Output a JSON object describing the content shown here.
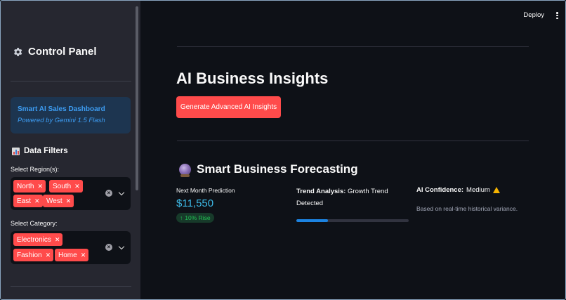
{
  "sidebar": {
    "title": "Control Panel",
    "title_icon": "gear-icon",
    "info": {
      "title": "Smart AI Sales Dashboard",
      "subtitle": "Powered by Gemini 1.5 Flash"
    },
    "filters_title": "Data Filters",
    "filters_icon": "bar-chart-icon",
    "region": {
      "label": "Select Region(s):",
      "selected": [
        "North",
        "South",
        "East",
        "West"
      ]
    },
    "category": {
      "label": "Select Category:",
      "selected": [
        "Electronics",
        "Fashion",
        "Home"
      ]
    }
  },
  "header": {
    "deploy_label": "Deploy",
    "menu_icon": "kebab-menu-icon"
  },
  "main": {
    "title": "AI Business Insights",
    "generate_button": "Generate Advanced AI Insights",
    "forecast": {
      "title": "Smart Business Forecasting",
      "icon": "crystal-ball-icon",
      "metric_label": "Next Month Prediction",
      "metric_value": "$11,550",
      "delta": "10% Rise",
      "trend_label": "Trend Analysis:",
      "trend_value": "Growth Trend Detected",
      "trend_progress": 0.28,
      "confidence_label": "AI Confidence:",
      "confidence_value": "Medium",
      "confidence_caption": "Based on real-time historical variance."
    }
  },
  "colors": {
    "accent": "#ff4b4b",
    "metric": "#3dbbe8",
    "delta": "#21c354",
    "progress": "#1c83e1",
    "info": "#3d9df3"
  }
}
